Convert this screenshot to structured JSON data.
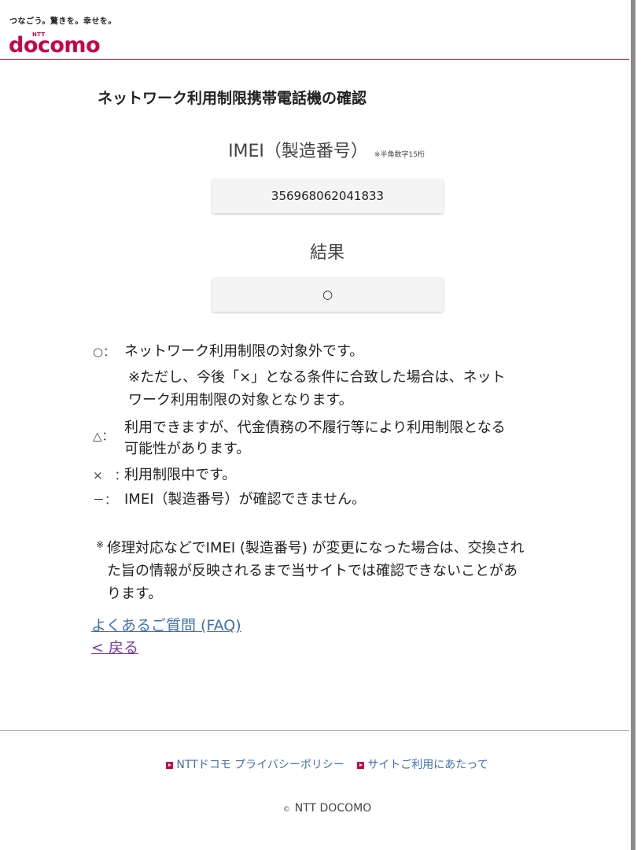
{
  "header": {
    "tagline": "つなごう。驚きを。幸せを。",
    "logo_small": "NTT",
    "logo": "docomo"
  },
  "page_title": "ネットワーク利用制限携帯電話機の確認",
  "imei": {
    "label": "IMEI（製造番号）",
    "note": "※半角数字15桁",
    "value": "356968062041833"
  },
  "result": {
    "label": "結果",
    "value": "○"
  },
  "legend": [
    {
      "symbol": "○：",
      "lines": [
        "ネットワーク利用制限の対象外です。",
        "※ただし、今後「×」となる条件に合致した場合は、ネット",
        "ワーク利用制限の対象となります。"
      ]
    },
    {
      "symbol": "△：",
      "lines": [
        "利用できますが、代金債務の不履行等により利用制限となる",
        "可能性があります。"
      ]
    },
    {
      "symbol": "×　：",
      "lines": [
        "利用制限中です。"
      ]
    },
    {
      "symbol": "－：",
      "lines": [
        "IMEI（製造番号）が確認できません。"
      ]
    }
  ],
  "note": {
    "mark": "※",
    "lines": [
      "修理対応などでIMEI (製造番号) が変更になった場合は、交換され",
      "た旨の情報が反映されるまで当サイトでは確認できないことがあ",
      "ります。"
    ]
  },
  "links": {
    "faq": "よくあるご質問 (FAQ)",
    "back": "< 戻る"
  },
  "footer": {
    "privacy": "NTTドコモ プライバシーポリシー",
    "terms": "サイトご利用にあたって",
    "copyright_symbol": "©",
    "copyright": "NTT DOCOMO"
  },
  "colors": {
    "brand": "#c9024a",
    "link": "#3f6fb0",
    "visited_link": "#7a3aa8"
  }
}
